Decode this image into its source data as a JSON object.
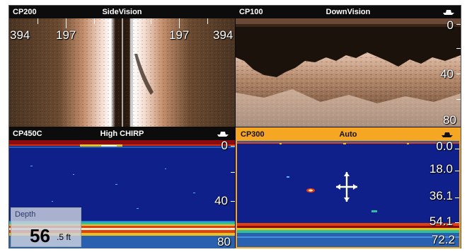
{
  "panes": {
    "sidevision": {
      "label": "CP200",
      "mode": "SideVision",
      "ranges": [
        "394",
        "197",
        "197",
        "394"
      ]
    },
    "downvision": {
      "label": "CP100",
      "mode": "DownVision",
      "depths": [
        "0",
        "40",
        "80"
      ]
    },
    "chirp": {
      "label": "CP450C",
      "mode": "High CHIRP",
      "depths": [
        "0",
        "40",
        "80"
      ]
    },
    "auto": {
      "label": "CP300",
      "mode": "Auto",
      "depths": [
        "0.0",
        "18.0",
        "36.1",
        "54.1",
        "72.2"
      ]
    }
  },
  "depth_readout": {
    "label": "Depth",
    "value": "56",
    "unit": ".5 ft"
  },
  "colors": {
    "active_title": "#f5a623",
    "title_bar": "#0c0c0c",
    "sonar_water": "#10208a",
    "bottom_return": "#8a0c10"
  },
  "icons": {
    "vessel": "boat-icon",
    "cursor": "crosshair-cursor-icon"
  }
}
